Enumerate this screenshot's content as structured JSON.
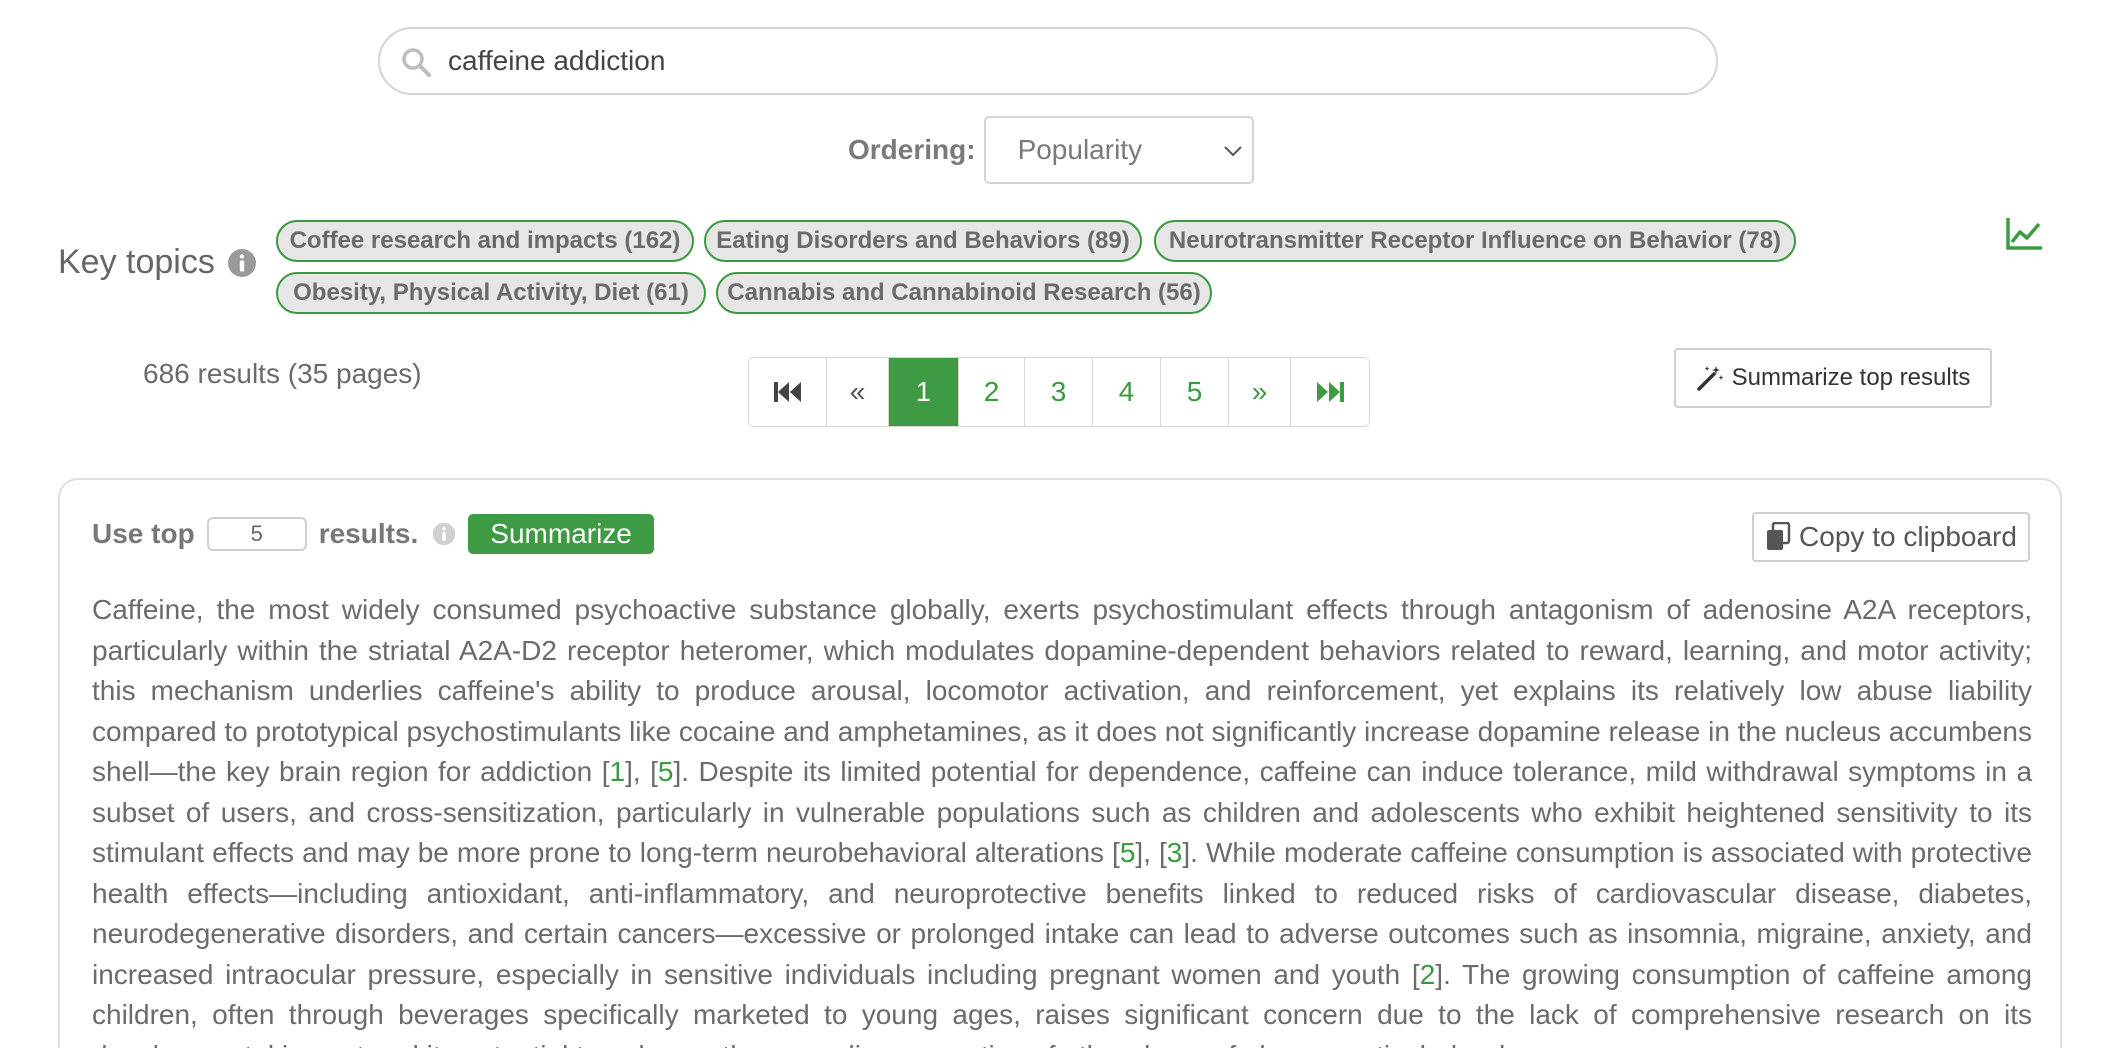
{
  "search": {
    "query": "caffeine addiction"
  },
  "ordering": {
    "label": "Ordering:",
    "selected": "Popularity"
  },
  "key_topics": {
    "label": "Key topics",
    "chips": [
      "Coffee research and impacts (162)",
      "Eating Disorders and Behaviors (89)",
      "Neurotransmitter Receptor Influence on Behavior (78)",
      "Obesity, Physical Activity, Diet (61)",
      "Cannabis and Cannabinoid Research (56)"
    ]
  },
  "results": {
    "summary": "686 results (35 pages)"
  },
  "pagination": {
    "first": "⏮",
    "prev": "«",
    "next": "»",
    "last": "⏭",
    "pages": [
      "1",
      "2",
      "3",
      "4",
      "5"
    ],
    "current": "1"
  },
  "summarize_top_button": "Summarize top results",
  "summary_card": {
    "use_top_prefix": "Use top",
    "top_n": "5",
    "use_top_suffix": "results.",
    "summarize_label": "Summarize",
    "copy_label": "Copy to clipboard",
    "text": {
      "p1": "Caffeine, the most widely consumed psychoactive substance globally, exerts psychostimulant effects through antagonism of adenosine A2A receptors, particularly within the striatal A2A-D2 receptor heteromer, which modulates dopamine-dependent behaviors related to reward, learning, and motor activity; this mechanism underlies caffeine's ability to produce arousal, locomotor activation, and reinforcement, yet explains its relatively low abuse liability compared to prototypical psychostimulants like cocaine and amphetamines, as it does not significantly increase dopamine release in the nucleus accumbens shell—the key brain region for addiction [",
      "c1": "1",
      "p2": "], [",
      "c2": "5",
      "p3": "]. Despite its limited potential for dependence, caffeine can induce tolerance, mild withdrawal symptoms in a subset of users, and cross-sensitization, particularly in vulnerable populations such as children and adolescents who exhibit heightened sensitivity to its stimulant effects and may be more prone to long-term neurobehavioral alterations [",
      "c3": "5",
      "p4": "], [",
      "c4": "3",
      "p5": "]. While moderate caffeine consumption is associated with protective health effects—including antioxidant, anti-inflammatory, and neuroprotective benefits linked to reduced risks of cardiovascular disease, diabetes, neurodegenerative disorders, and certain cancers—excessive or prolonged intake can lead to adverse outcomes such as insomnia, migraine, anxiety, and increased intraocular pressure, especially in sensitive individuals including pregnant women and youth [",
      "c5": "2",
      "p6": "]. The growing consumption of caffeine among children, often through beverages specifically marketed to young ages, raises significant concern due to the lack of comprehensive research on its developmental impact and its potential to enhance the rewarding properties of other drugs of abuse, particularly when"
    }
  },
  "colors": {
    "accent": "#3f9a44",
    "chip_bg": "#e6e6e6",
    "text": "#6b6b6b"
  }
}
